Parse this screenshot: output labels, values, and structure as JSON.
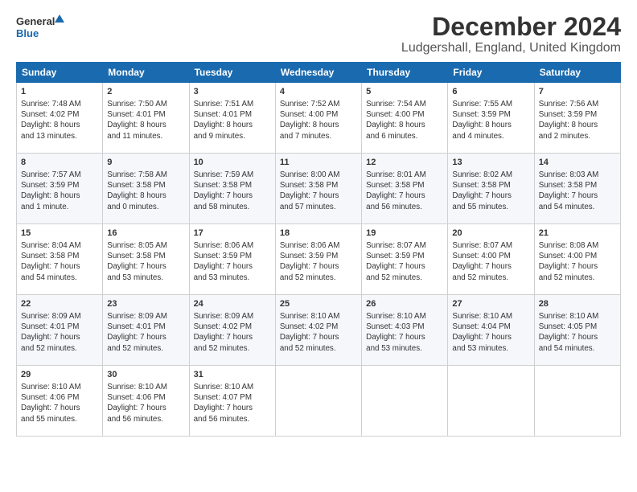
{
  "header": {
    "logo_line1": "General",
    "logo_line2": "Blue",
    "main_title": "December 2024",
    "subtitle": "Ludgershall, England, United Kingdom"
  },
  "columns": [
    "Sunday",
    "Monday",
    "Tuesday",
    "Wednesday",
    "Thursday",
    "Friday",
    "Saturday"
  ],
  "weeks": [
    [
      {
        "day": "1",
        "info": "Sunrise: 7:48 AM\nSunset: 4:02 PM\nDaylight: 8 hours\nand 13 minutes."
      },
      {
        "day": "2",
        "info": "Sunrise: 7:50 AM\nSunset: 4:01 PM\nDaylight: 8 hours\nand 11 minutes."
      },
      {
        "day": "3",
        "info": "Sunrise: 7:51 AM\nSunset: 4:01 PM\nDaylight: 8 hours\nand 9 minutes."
      },
      {
        "day": "4",
        "info": "Sunrise: 7:52 AM\nSunset: 4:00 PM\nDaylight: 8 hours\nand 7 minutes."
      },
      {
        "day": "5",
        "info": "Sunrise: 7:54 AM\nSunset: 4:00 PM\nDaylight: 8 hours\nand 6 minutes."
      },
      {
        "day": "6",
        "info": "Sunrise: 7:55 AM\nSunset: 3:59 PM\nDaylight: 8 hours\nand 4 minutes."
      },
      {
        "day": "7",
        "info": "Sunrise: 7:56 AM\nSunset: 3:59 PM\nDaylight: 8 hours\nand 2 minutes."
      }
    ],
    [
      {
        "day": "8",
        "info": "Sunrise: 7:57 AM\nSunset: 3:59 PM\nDaylight: 8 hours\nand 1 minute."
      },
      {
        "day": "9",
        "info": "Sunrise: 7:58 AM\nSunset: 3:58 PM\nDaylight: 8 hours\nand 0 minutes."
      },
      {
        "day": "10",
        "info": "Sunrise: 7:59 AM\nSunset: 3:58 PM\nDaylight: 7 hours\nand 58 minutes."
      },
      {
        "day": "11",
        "info": "Sunrise: 8:00 AM\nSunset: 3:58 PM\nDaylight: 7 hours\nand 57 minutes."
      },
      {
        "day": "12",
        "info": "Sunrise: 8:01 AM\nSunset: 3:58 PM\nDaylight: 7 hours\nand 56 minutes."
      },
      {
        "day": "13",
        "info": "Sunrise: 8:02 AM\nSunset: 3:58 PM\nDaylight: 7 hours\nand 55 minutes."
      },
      {
        "day": "14",
        "info": "Sunrise: 8:03 AM\nSunset: 3:58 PM\nDaylight: 7 hours\nand 54 minutes."
      }
    ],
    [
      {
        "day": "15",
        "info": "Sunrise: 8:04 AM\nSunset: 3:58 PM\nDaylight: 7 hours\nand 54 minutes."
      },
      {
        "day": "16",
        "info": "Sunrise: 8:05 AM\nSunset: 3:58 PM\nDaylight: 7 hours\nand 53 minutes."
      },
      {
        "day": "17",
        "info": "Sunrise: 8:06 AM\nSunset: 3:59 PM\nDaylight: 7 hours\nand 53 minutes."
      },
      {
        "day": "18",
        "info": "Sunrise: 8:06 AM\nSunset: 3:59 PM\nDaylight: 7 hours\nand 52 minutes."
      },
      {
        "day": "19",
        "info": "Sunrise: 8:07 AM\nSunset: 3:59 PM\nDaylight: 7 hours\nand 52 minutes."
      },
      {
        "day": "20",
        "info": "Sunrise: 8:07 AM\nSunset: 4:00 PM\nDaylight: 7 hours\nand 52 minutes."
      },
      {
        "day": "21",
        "info": "Sunrise: 8:08 AM\nSunset: 4:00 PM\nDaylight: 7 hours\nand 52 minutes."
      }
    ],
    [
      {
        "day": "22",
        "info": "Sunrise: 8:09 AM\nSunset: 4:01 PM\nDaylight: 7 hours\nand 52 minutes."
      },
      {
        "day": "23",
        "info": "Sunrise: 8:09 AM\nSunset: 4:01 PM\nDaylight: 7 hours\nand 52 minutes."
      },
      {
        "day": "24",
        "info": "Sunrise: 8:09 AM\nSunset: 4:02 PM\nDaylight: 7 hours\nand 52 minutes."
      },
      {
        "day": "25",
        "info": "Sunrise: 8:10 AM\nSunset: 4:02 PM\nDaylight: 7 hours\nand 52 minutes."
      },
      {
        "day": "26",
        "info": "Sunrise: 8:10 AM\nSunset: 4:03 PM\nDaylight: 7 hours\nand 53 minutes."
      },
      {
        "day": "27",
        "info": "Sunrise: 8:10 AM\nSunset: 4:04 PM\nDaylight: 7 hours\nand 53 minutes."
      },
      {
        "day": "28",
        "info": "Sunrise: 8:10 AM\nSunset: 4:05 PM\nDaylight: 7 hours\nand 54 minutes."
      }
    ],
    [
      {
        "day": "29",
        "info": "Sunrise: 8:10 AM\nSunset: 4:06 PM\nDaylight: 7 hours\nand 55 minutes."
      },
      {
        "day": "30",
        "info": "Sunrise: 8:10 AM\nSunset: 4:06 PM\nDaylight: 7 hours\nand 56 minutes."
      },
      {
        "day": "31",
        "info": "Sunrise: 8:10 AM\nSunset: 4:07 PM\nDaylight: 7 hours\nand 56 minutes."
      },
      {
        "day": "",
        "info": ""
      },
      {
        "day": "",
        "info": ""
      },
      {
        "day": "",
        "info": ""
      },
      {
        "day": "",
        "info": ""
      }
    ]
  ]
}
